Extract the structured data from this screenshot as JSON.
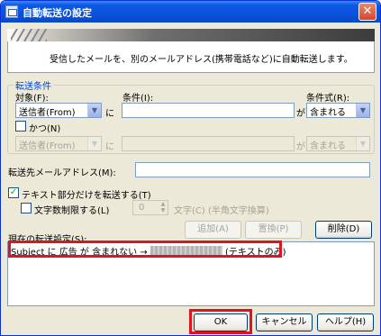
{
  "window": {
    "title": "自動転送の設定",
    "close_glyph": "✕"
  },
  "info": {
    "text": "受信したメールを、別のメールアドレス(携帯電話など)に自動転送します。"
  },
  "conditions": {
    "group_label": "転送条件",
    "target_label": "対象(F):",
    "condition_label": "条件(I):",
    "operator_label": "条件式(R):",
    "row1": {
      "target": "送信者(From)",
      "connector": "に",
      "value": "",
      "ga": "が",
      "operator": "含まれる"
    },
    "and_label": "かつ(N)",
    "row2": {
      "target": "送信者(From)",
      "connector": "に",
      "value": "",
      "ga": "が",
      "operator": "含まれる"
    }
  },
  "forward": {
    "address_label": "転送先メールアドレス(M):",
    "address_value": ""
  },
  "text_only": {
    "label": "テキスト部分だけを転送する(T)",
    "checked": true
  },
  "limit": {
    "label": "文字数制限する(L)",
    "value": "0",
    "unit_label": "文字(C) (半角文字換算)"
  },
  "actions": {
    "add": "追加(A)",
    "replace": "置換(P)",
    "delete": "削除(D)"
  },
  "current": {
    "label": "現在の転送設定(S):",
    "row_prefix": "Subject に 広告 が 含まれない →",
    "row_suffix": "(テキストのみ)"
  },
  "footer": {
    "ok": "OK",
    "cancel": "キャンセル",
    "help": "ヘルプ(H)"
  },
  "colors": {
    "highlight": "#e0141e",
    "title_bar": "#0a52dc"
  }
}
